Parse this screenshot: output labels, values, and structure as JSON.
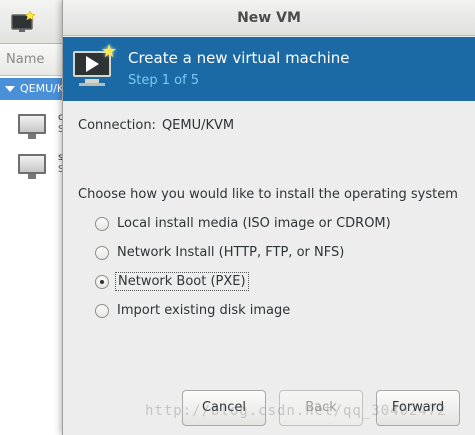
{
  "background_app": {
    "list_header": "Name",
    "connection_row": "QEMU/K",
    "vm_items": [
      {
        "name": "c",
        "state": "S"
      },
      {
        "name": "s",
        "state": "S"
      }
    ]
  },
  "dialog": {
    "title": "New VM",
    "banner": {
      "heading": "Create a new virtual machine",
      "step": "Step 1 of 5",
      "icon": "new-vm-icon"
    },
    "connection_label": "Connection:",
    "connection_value": "QEMU/KVM",
    "question": "Choose how you would like to install the operating system",
    "install_options": [
      {
        "label": "Local install media (ISO image or CDROM)",
        "selected": false
      },
      {
        "label": "Network Install (HTTP, FTP, or NFS)",
        "selected": false
      },
      {
        "label": "Network Boot (PXE)",
        "selected": true
      },
      {
        "label": "Import existing disk image",
        "selected": false
      }
    ],
    "buttons": {
      "cancel": "Cancel",
      "back": "Back",
      "forward": "Forward"
    }
  },
  "watermark": "http://blog.csdn.net/qq_30402472",
  "colors": {
    "banner_bg": "#1b6aa5",
    "banner_step": "#7fc6f5",
    "selection_blue": "#4a90d9"
  }
}
